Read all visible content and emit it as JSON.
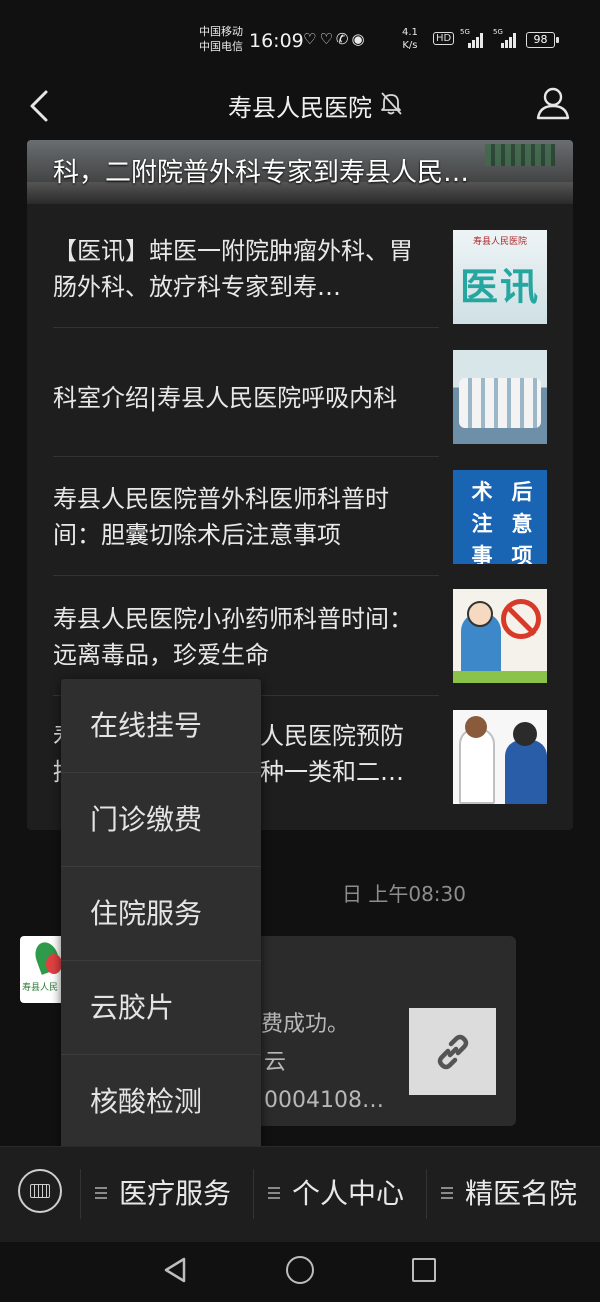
{
  "status_bar": {
    "carrier_1": "中国移动",
    "carrier_2": "中国电信",
    "time": "16:09",
    "speed_value": "4.1",
    "speed_unit": "K/s",
    "hd": "HD",
    "net_1": "5G",
    "net_2": "5G",
    "battery": "98"
  },
  "nav": {
    "title": "寿县人民医院",
    "icons": [
      "back-arrow-icon",
      "mute-bell-icon",
      "profile-icon"
    ]
  },
  "articles": {
    "banner_title": "科，二附院普外科专家到寿县人民…",
    "items": [
      {
        "title": "【医讯】蚌医一附院肿瘤外科、胃肠外科、放疗科专家到寿…",
        "thumb_header": "寿县人民医院",
        "thumb_main": "医讯"
      },
      {
        "title": "科室介绍|寿县人民医院呼吸内科"
      },
      {
        "title": "寿县人民医院普外科医师科普时间：胆囊切除术后注意事项",
        "thumb_chars": [
          "术",
          "后",
          "注",
          "意",
          "事",
          "项"
        ]
      },
      {
        "title": "寿县人民医院小孙药师科普时间：远离毒品，珍爱生命"
      },
      {
        "title": "寿县人民医院预防接种一类和二…",
        "visible_left": "寿",
        "visible_right": "人民医院预防",
        "visible_left_2": "接",
        "visible_right_2": "种一类和二…"
      }
    ]
  },
  "timestamp": "日 上午08:30",
  "message": {
    "avatar_text": "寿县人民",
    "line_1": "费成功。",
    "line_2": "云",
    "line_3": "0004108…",
    "link_icon": "link-icon"
  },
  "popup_menu": {
    "items": [
      "在线挂号",
      "门诊缴费",
      "住院服务",
      "云胶片",
      "核酸检测"
    ]
  },
  "bottom_menu": {
    "items": [
      "医疗服务",
      "个人中心",
      "精医名院"
    ]
  }
}
